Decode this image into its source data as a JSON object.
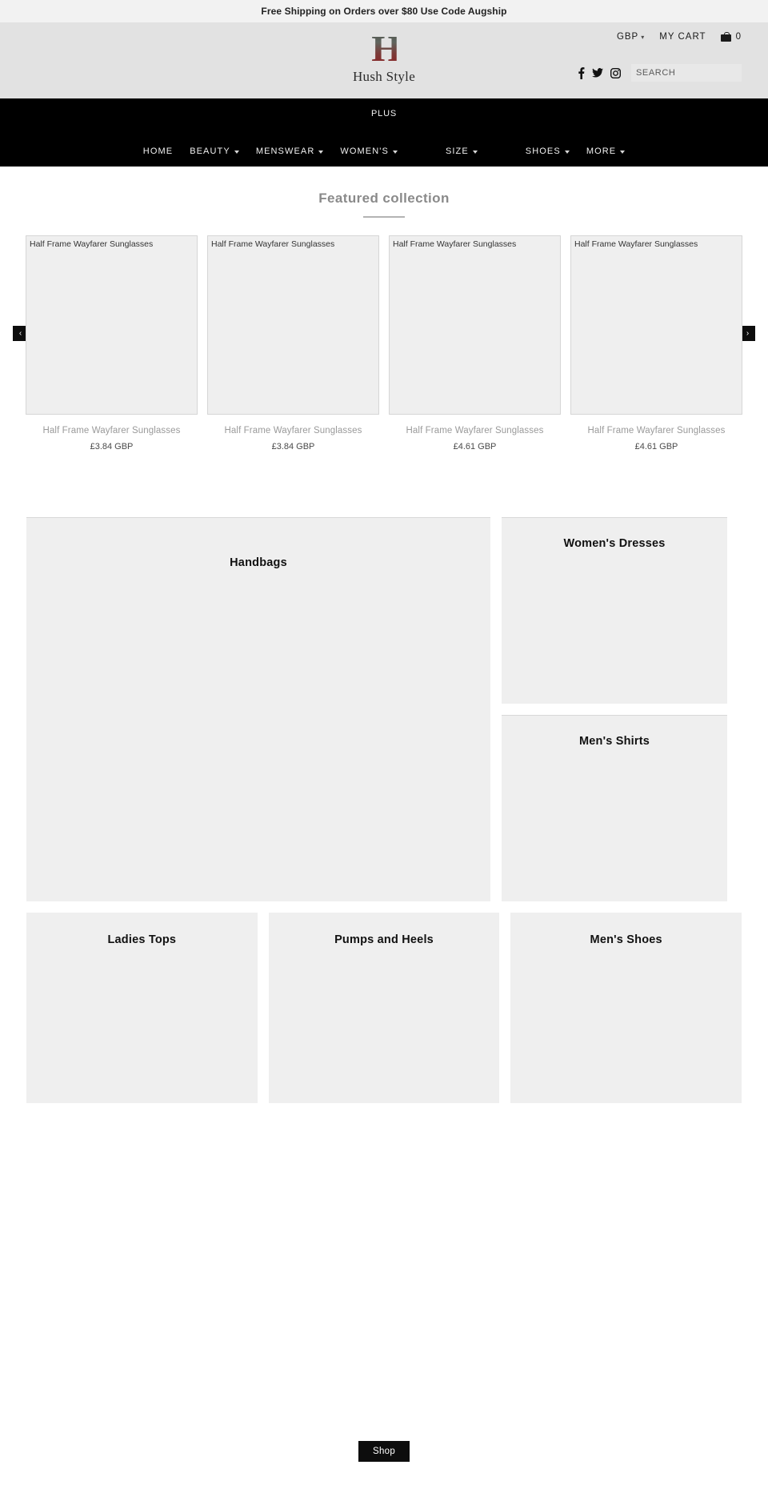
{
  "announcement": {
    "text": "Free Shipping on Orders over $80 Use Code Augship"
  },
  "header": {
    "logo_mark": "H",
    "brand_name": "Hush Style",
    "currency": "GBP",
    "currency_caret": "⌄",
    "my_cart_label": "MY CART",
    "cart_count": "0",
    "cart_icon": "shopping-bag-icon",
    "social": [
      {
        "name": "facebook-icon",
        "label": "Facebook"
      },
      {
        "name": "twitter-icon",
        "label": "Twitter"
      },
      {
        "name": "instagram-icon",
        "label": "Instagram"
      }
    ],
    "search_placeholder": "SEARCH",
    "search_value": ""
  },
  "nav": {
    "plus_label": "PLUS",
    "items": [
      {
        "label": "HOME",
        "has_dropdown": false
      },
      {
        "label": "BEAUTY",
        "has_dropdown": true
      },
      {
        "label": "MENSWEAR",
        "has_dropdown": true
      },
      {
        "label": "WOMEN'S",
        "has_dropdown": true
      },
      {
        "label": "SIZE",
        "has_dropdown": true
      },
      {
        "label": "SHOES",
        "has_dropdown": true
      },
      {
        "label": "MORE",
        "has_dropdown": true
      }
    ]
  },
  "featured": {
    "title": "Featured collection",
    "prev_arrow": "‹",
    "next_arrow": "›",
    "products": [
      {
        "alt_text": "Half Frame Wayfarer Sunglasses",
        "title": "Half Frame Wayfarer Sunglasses",
        "price": "£3.84 GBP"
      },
      {
        "alt_text": "Half Frame Wayfarer Sunglasses",
        "title": "Half Frame Wayfarer Sunglasses",
        "price": "£3.84 GBP"
      },
      {
        "alt_text": "Half Frame Wayfarer Sunglasses",
        "title": "Half Frame Wayfarer Sunglasses",
        "price": "£4.61 GBP"
      },
      {
        "alt_text": "Half Frame Wayfarer Sunglasses",
        "title": "Half Frame Wayfarer Sunglasses",
        "price": "£4.61 GBP"
      }
    ]
  },
  "collections": {
    "handbags": "Handbags",
    "womens_dresses": "Women's Dresses",
    "mens_shirts": "Men's Shirts",
    "ladies_tops": "Ladies Tops",
    "pumps_and_heels": "Pumps and Heels",
    "mens_shoes": "Men's Shoes"
  },
  "footer": {
    "shop_button": "Shop"
  },
  "colors": {
    "announce_bg": "#f2f2f2",
    "header_bg": "#e2e2e2",
    "nav_bg": "#000000",
    "tile_bg": "#efefef",
    "accent_text": "#8a8a8a",
    "logo_top": "#4e534d",
    "logo_bottom": "#8e1f22"
  }
}
